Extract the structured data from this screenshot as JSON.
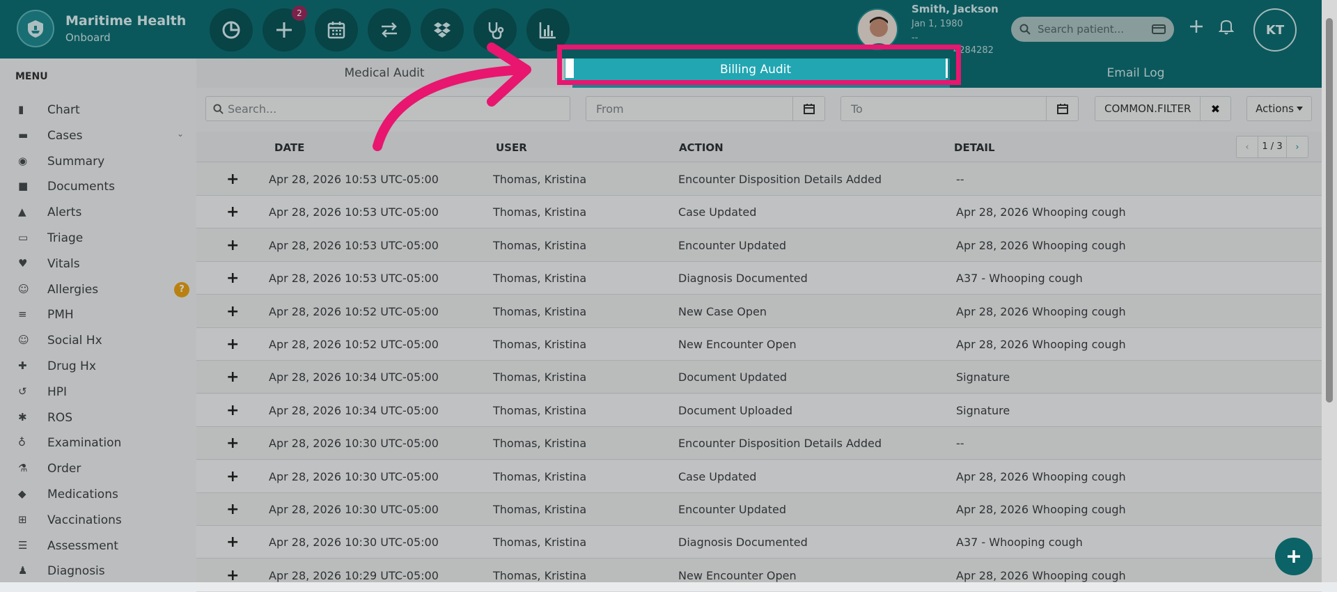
{
  "brand": {
    "name": "Maritime Health",
    "subtitle": "Onboard"
  },
  "toolbar": {
    "badge_count": "2",
    "icons": [
      "pie-chart-icon",
      "plus-icon",
      "calendar-icon",
      "swap-icon",
      "dropbox-icon",
      "stethoscope-icon",
      "bar-chart-icon"
    ]
  },
  "patient": {
    "name": "Smith, Jackson",
    "dob": "Jan 1, 1980",
    "line2": "--",
    "line3": "4284282"
  },
  "search_patient": {
    "placeholder": "Search patient..."
  },
  "user": {
    "initials": "KT"
  },
  "menu": {
    "title": "MENU",
    "items": [
      {
        "label": "Chart",
        "icon": "bar-chart-icon"
      },
      {
        "label": "Cases",
        "icon": "archive-icon"
      },
      {
        "label": "Summary",
        "icon": "eye-icon"
      },
      {
        "label": "Documents",
        "icon": "folder-icon"
      },
      {
        "label": "Alerts",
        "icon": "warning-icon"
      },
      {
        "label": "Triage",
        "icon": "inbox-icon"
      },
      {
        "label": "Vitals",
        "icon": "heart-icon"
      },
      {
        "label": "Allergies",
        "icon": "smile-icon"
      },
      {
        "label": "PMH",
        "icon": "sort-icon"
      },
      {
        "label": "Social Hx",
        "icon": "smile-icon"
      },
      {
        "label": "Drug Hx",
        "icon": "medkit-icon"
      },
      {
        "label": "HPI",
        "icon": "history-icon"
      },
      {
        "label": "ROS",
        "icon": "gear-icon"
      },
      {
        "label": "Examination",
        "icon": "stethoscope-icon"
      },
      {
        "label": "Order",
        "icon": "flask-icon"
      },
      {
        "label": "Medications",
        "icon": "eraser-icon"
      },
      {
        "label": "Vaccinations",
        "icon": "plus-square-icon"
      },
      {
        "label": "Assessment",
        "icon": "list-icon"
      },
      {
        "label": "Diagnosis",
        "icon": "user-md-icon"
      }
    ],
    "allergies_badge": "?"
  },
  "tabs": [
    {
      "label": "Medical Audit"
    },
    {
      "label": "Billing Audit"
    },
    {
      "label": "Email Log"
    }
  ],
  "filters": {
    "search_placeholder": "Search...",
    "from_placeholder": "From",
    "to_placeholder": "To",
    "filter_label": "COMMON.FILTER",
    "clear_icon": "✖",
    "actions_label": "Actions"
  },
  "table": {
    "headers": {
      "date": "DATE",
      "user": "USER",
      "action": "ACTION",
      "detail": "DETAIL"
    },
    "pagination": "1 / 3",
    "rows": [
      {
        "date": "Apr 28, 2026 10:53 UTC-05:00",
        "user": "Thomas, Kristina",
        "action": "Encounter Disposition Details Added",
        "detail": "--"
      },
      {
        "date": "Apr 28, 2026 10:53 UTC-05:00",
        "user": "Thomas, Kristina",
        "action": "Case Updated",
        "detail": "Apr 28, 2026 Whooping cough"
      },
      {
        "date": "Apr 28, 2026 10:53 UTC-05:00",
        "user": "Thomas, Kristina",
        "action": "Encounter Updated",
        "detail": "Apr 28, 2026 Whooping cough"
      },
      {
        "date": "Apr 28, 2026 10:53 UTC-05:00",
        "user": "Thomas, Kristina",
        "action": "Diagnosis Documented",
        "detail": "A37 - Whooping cough"
      },
      {
        "date": "Apr 28, 2026 10:52 UTC-05:00",
        "user": "Thomas, Kristina",
        "action": "New Case Open",
        "detail": "Apr 28, 2026 Whooping cough"
      },
      {
        "date": "Apr 28, 2026 10:52 UTC-05:00",
        "user": "Thomas, Kristina",
        "action": "New Encounter Open",
        "detail": "Apr 28, 2026 Whooping cough"
      },
      {
        "date": "Apr 28, 2026 10:34 UTC-05:00",
        "user": "Thomas, Kristina",
        "action": "Document Updated",
        "detail": "Signature"
      },
      {
        "date": "Apr 28, 2026 10:34 UTC-05:00",
        "user": "Thomas, Kristina",
        "action": "Document Uploaded",
        "detail": "Signature"
      },
      {
        "date": "Apr 28, 2026 10:30 UTC-05:00",
        "user": "Thomas, Kristina",
        "action": "Encounter Disposition Details Added",
        "detail": "--"
      },
      {
        "date": "Apr 28, 2026 10:30 UTC-05:00",
        "user": "Thomas, Kristina",
        "action": "Case Updated",
        "detail": "Apr 28, 2026 Whooping cough"
      },
      {
        "date": "Apr 28, 2026 10:30 UTC-05:00",
        "user": "Thomas, Kristina",
        "action": "Encounter Updated",
        "detail": "Apr 28, 2026 Whooping cough"
      },
      {
        "date": "Apr 28, 2026 10:30 UTC-05:00",
        "user": "Thomas, Kristina",
        "action": "Diagnosis Documented",
        "detail": "A37 - Whooping cough"
      },
      {
        "date": "Apr 28, 2026 10:29 UTC-05:00",
        "user": "Thomas, Kristina",
        "action": "New Encounter Open",
        "detail": "Apr 28, 2026 Whooping cough"
      }
    ]
  },
  "colors": {
    "primary": "#0d6e73",
    "active_tab": "#21a6b2",
    "highlight": "#e8166f"
  }
}
